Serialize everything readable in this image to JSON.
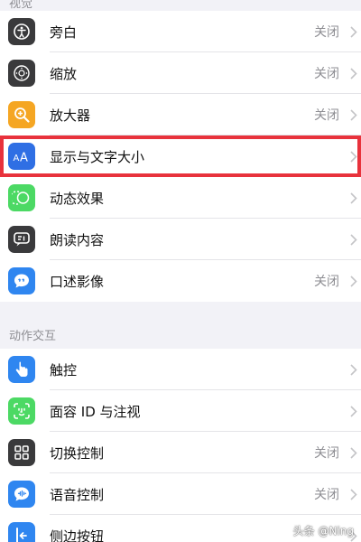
{
  "section_vision": {
    "title": "视觉"
  },
  "vision_items": [
    {
      "name": "voiceover",
      "label": "旁白",
      "value": "关闭",
      "icon": "accessibility-icon",
      "color": "#3a3a3c"
    },
    {
      "name": "zoom",
      "label": "缩放",
      "value": "关闭",
      "icon": "zoom-icon",
      "color": "#3a3a3c"
    },
    {
      "name": "magnifier",
      "label": "放大器",
      "value": "关闭",
      "icon": "magnifier-icon",
      "color": "#f5a623"
    },
    {
      "name": "display-text-size",
      "label": "显示与文字大小",
      "value": "",
      "icon": "text-size-icon",
      "color": "#2f6fe4"
    },
    {
      "name": "motion",
      "label": "动态效果",
      "value": "",
      "icon": "motion-icon",
      "color": "#4cd964"
    },
    {
      "name": "spoken-content",
      "label": "朗读内容",
      "value": "",
      "icon": "speech-icon",
      "color": "#3a3a3c"
    },
    {
      "name": "audio-descriptions",
      "label": "口述影像",
      "value": "关闭",
      "icon": "audio-description-icon",
      "color": "#2f86f0"
    }
  ],
  "section_interaction": {
    "title": "动作交互"
  },
  "interaction_items": [
    {
      "name": "touch",
      "label": "触控",
      "value": "",
      "icon": "hand-icon",
      "color": "#2f86f0"
    },
    {
      "name": "face-id",
      "label": "面容 ID 与注视",
      "value": "",
      "icon": "face-id-icon",
      "color": "#4cd964"
    },
    {
      "name": "switch-control",
      "label": "切换控制",
      "value": "关闭",
      "icon": "grid-icon",
      "color": "#3a3a3c"
    },
    {
      "name": "voice-control",
      "label": "语音控制",
      "value": "关闭",
      "icon": "voice-control-icon",
      "color": "#2f86f0"
    },
    {
      "name": "side-button",
      "label": "侧边按钮",
      "value": "",
      "icon": "side-button-icon",
      "color": "#2f86f0"
    }
  ],
  "watermark": "头条 @Ning"
}
